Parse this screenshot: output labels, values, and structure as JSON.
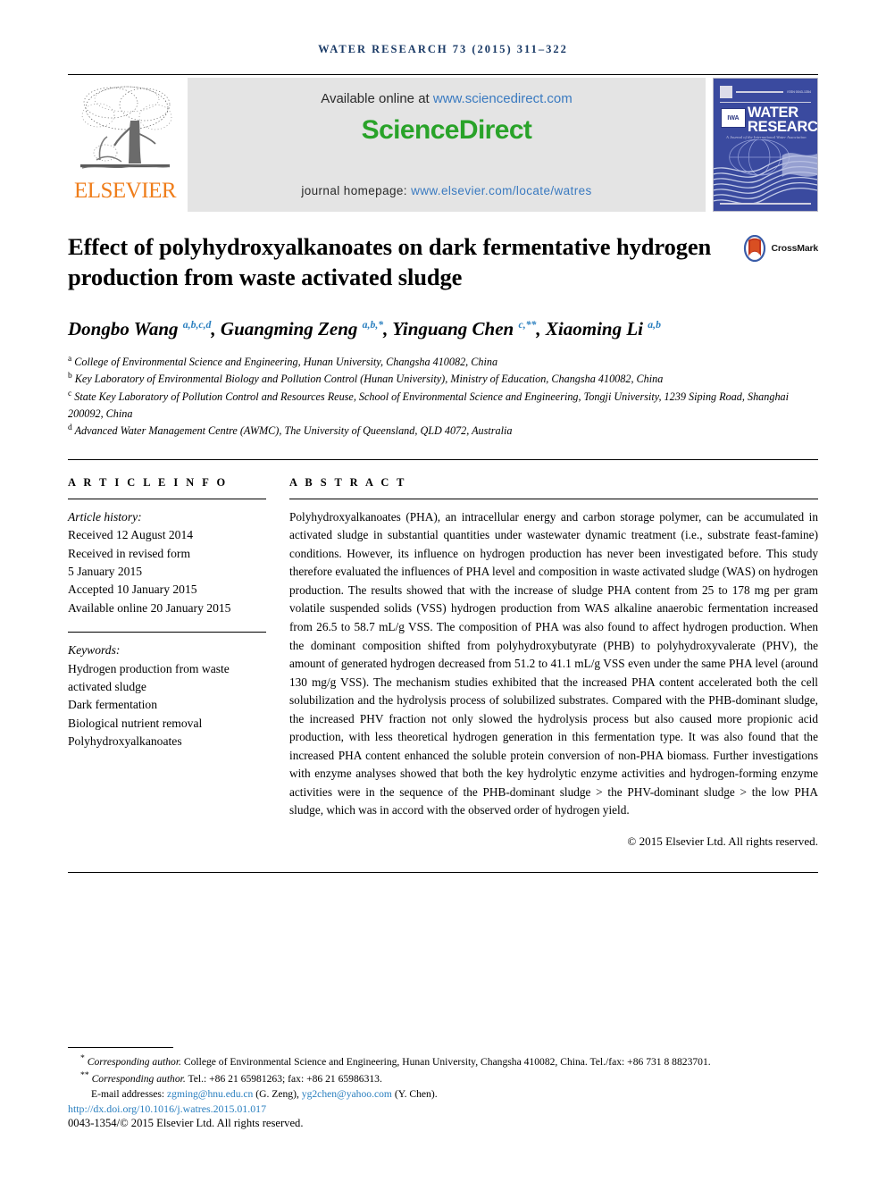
{
  "running_head": "WATER RESEARCH 73 (2015) 311–322",
  "masthead": {
    "publisher_name": "ELSEVIER",
    "available_prefix": "Available online at ",
    "available_link": "www.sciencedirect.com",
    "sciencedirect_logo": "ScienceDirect",
    "homepage_prefix": "journal homepage: ",
    "homepage_link": "www.elsevier.com/locate/watres",
    "journal_cover": {
      "title_line1": "WATER",
      "title_line2": "RESEARCH",
      "badge": "IWA",
      "issn_tag": "ISSN 0043-1354",
      "subtitle": "A Journal of the International Water Association"
    },
    "colors": {
      "sciencedirect_green": "#29a329",
      "elsevier_orange": "#ef7d1a",
      "link_blue": "#3a7ac0",
      "banner_gray": "#e4e4e4",
      "cover_blue": "#3a4a9f"
    }
  },
  "article": {
    "title": "Effect of polyhydroxyalkanoates on dark fermentative hydrogen production from waste activated sludge",
    "crossmark_label": "CrossMark",
    "authors_html": "Dongbo Wang <sup>a,b,c,d</sup>, Guangming Zeng <sup>a,b,*</sup>, Yinguang Chen <sup>c,**</sup>, Xiaoming Li <sup>a,b</sup>",
    "affiliations": [
      {
        "marker": "a",
        "text": "College of Environmental Science and Engineering, Hunan University, Changsha 410082, China"
      },
      {
        "marker": "b",
        "text": "Key Laboratory of Environmental Biology and Pollution Control (Hunan University), Ministry of Education, Changsha 410082, China"
      },
      {
        "marker": "c",
        "text": "State Key Laboratory of Pollution Control and Resources Reuse, School of Environmental Science and Engineering, Tongji University, 1239 Siping Road, Shanghai 200092, China"
      },
      {
        "marker": "d",
        "text": "Advanced Water Management Centre (AWMC), The University of Queensland, QLD 4072, Australia"
      }
    ]
  },
  "article_info": {
    "heading": "A R T I C L E  I N F O",
    "history_label": "Article history:",
    "history": [
      "Received 12 August 2014",
      "Received in revised form",
      "5 January 2015",
      "Accepted 10 January 2015",
      "Available online 20 January 2015"
    ],
    "keywords_label": "Keywords:",
    "keywords": [
      "Hydrogen production from waste activated sludge",
      "Dark fermentation",
      "Biological nutrient removal",
      "Polyhydroxyalkanoates"
    ]
  },
  "abstract": {
    "heading": "A B S T R A C T",
    "text": "Polyhydroxyalkanoates (PHA), an intracellular energy and carbon storage polymer, can be accumulated in activated sludge in substantial quantities under wastewater dynamic treatment (i.e., substrate feast-famine) conditions. However, its influence on hydrogen production has never been investigated before. This study therefore evaluated the influences of PHA level and composition in waste activated sludge (WAS) on hydrogen production. The results showed that with the increase of sludge PHA content from 25 to 178 mg per gram volatile suspended solids (VSS) hydrogen production from WAS alkaline anaerobic fermentation increased from 26.5 to 58.7 mL/g VSS. The composition of PHA was also found to affect hydrogen production. When the dominant composition shifted from polyhydroxybutyrate (PHB) to polyhydroxyvalerate (PHV), the amount of generated hydrogen decreased from 51.2 to 41.1 mL/g VSS even under the same PHA level (around 130 mg/g VSS). The mechanism studies exhibited that the increased PHA content accelerated both the cell solubilization and the hydrolysis process of solubilized substrates. Compared with the PHB-dominant sludge, the increased PHV fraction not only slowed the hydrolysis process but also caused more propionic acid production, with less theoretical hydrogen generation in this fermentation type. It was also found that the increased PHA content enhanced the soluble protein conversion of non-PHA biomass. Further investigations with enzyme analyses showed that both the key hydrolytic enzyme activities and hydrogen-forming enzyme activities were in the sequence of the PHB-dominant sludge > the PHV-dominant sludge > the low PHA sludge, which was in accord with the observed order of hydrogen yield.",
    "copyright": "© 2015 Elsevier Ltd. All rights reserved."
  },
  "footnotes": {
    "corr1_marker": "*",
    "corr1_italic": "Corresponding author.",
    "corr1_text": " College of Environmental Science and Engineering, Hunan University, Changsha 410082, China. Tel./fax: +86 731 8 8823701.",
    "corr2_marker": "**",
    "corr2_italic": "Corresponding author.",
    "corr2_text": " Tel.: +86 21 65981263; fax: +86 21 65986313.",
    "email_label": "E-mail addresses:",
    "email1": "zgming@hnu.edu.cn",
    "email1_attrib": "(G. Zeng),",
    "email2": "yg2chen@yahoo.com",
    "email2_attrib": "(Y. Chen).",
    "doi": "http://dx.doi.org/10.1016/j.watres.2015.01.017",
    "issn_line": "0043-1354/© 2015 Elsevier Ltd. All rights reserved."
  }
}
